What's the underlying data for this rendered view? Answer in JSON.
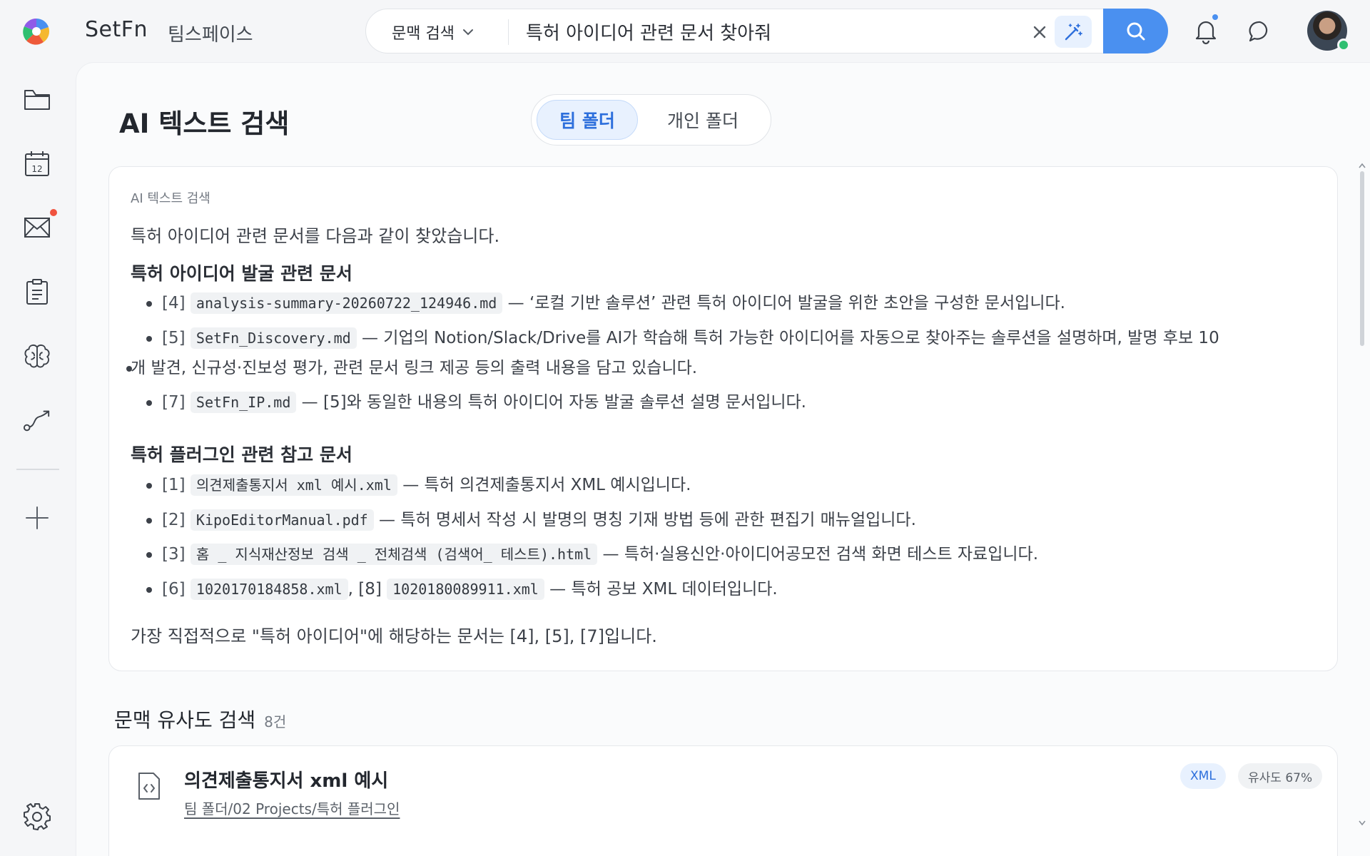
{
  "app": {
    "brand": "SetFn",
    "workspace": "팀스페이스"
  },
  "search": {
    "mode": "문맥 검색",
    "query": "특허 아이디어 관련 문서 찾아줘"
  },
  "page": {
    "title": "AI 텍스트 검색",
    "tabs": [
      {
        "label": "팀 폴더",
        "active": true
      },
      {
        "label": "개인 폴더",
        "active": false
      }
    ]
  },
  "answer": {
    "label": "AI 텍스트 검색",
    "intro": "특허 아이디어 관련 문서를 다음과 같이 찾았습니다.",
    "sections": [
      {
        "heading": "특허 아이디어 발굴 관련 문서",
        "items": [
          {
            "ref": "[4]",
            "file": "analysis-summary-20260722_124946.md",
            "text": "— ‘로컬 기반 솔루션’ 관련 특허 아이디어 발굴을 위한 초안을 구성한 문서입니다."
          },
          {
            "ref": "[5]",
            "file": "SetFn_Discovery.md",
            "text": "— 기업의 Notion/Slack/Drive를 AI가 학습해 특허 가능한 아이디어를 자동으로 찾아주는 솔루션을 설명하며, 발명 후보 10",
            "text2": "개 발견, 신규성·진보성 평가, 관련 문서 링크 제공 등의 출력 내용을 담고 있습니다."
          },
          {
            "ref": "[7]",
            "file": "SetFn_IP.md",
            "text": "— [5]와 동일한 내용의 특허 아이디어 자동 발굴 솔루션 설명 문서입니다."
          }
        ]
      },
      {
        "heading": "특허 플러그인 관련 참고 문서",
        "items": [
          {
            "ref": "[1]",
            "file": "의견제출통지서 xml 예시.xml",
            "text": "— 특허 의견제출통지서 XML 예시입니다."
          },
          {
            "ref": "[2]",
            "file": "KipoEditorManual.pdf",
            "text": "— 특허 명세서 작성 시 발명의 명칭 기재 방법 등에 관한 편집기 매뉴얼입니다."
          },
          {
            "ref": "[3]",
            "file": "홈 _ 지식재산정보 검색 _ 전체검색 (검색어_ 테스트).html",
            "text": "— 특허·실용신안·아이디어공모전 검색 화면 테스트 자료입니다."
          },
          {
            "ref": "[6]",
            "file": "1020170184858.xml",
            "sep": ", [8]",
            "file2": "1020180089911.xml",
            "text": "— 특허 공보 XML 데이터입니다."
          }
        ]
      }
    ],
    "outro": "가장 직접적으로 \"특허 아이디어\"에 해당하는 문서는 [4], [5], [7]입니다."
  },
  "results": {
    "heading": "문맥 유사도 검색",
    "count": "8건",
    "items": [
      {
        "title": "의견제출통지서 xml 예시",
        "path": "팀 폴더/02 Projects/특허 플러그인",
        "type": "XML",
        "similarity": "유사도 67%"
      }
    ]
  },
  "colors": {
    "accent": "#4a90f0",
    "accent_soft": "#e8f1fe",
    "notification_dot": "#f0533f",
    "online": "#2fbf71"
  },
  "icons": [
    "folder-icon",
    "calendar-icon",
    "mail-icon",
    "clipboard-icon",
    "brain-icon",
    "route-icon",
    "plus-icon",
    "gear-icon",
    "bell-icon",
    "chat-icon",
    "search-icon",
    "magic-wand-icon",
    "close-icon",
    "chevron-down-icon",
    "code-file-icon"
  ],
  "rail": {
    "calendar_day": "12"
  }
}
